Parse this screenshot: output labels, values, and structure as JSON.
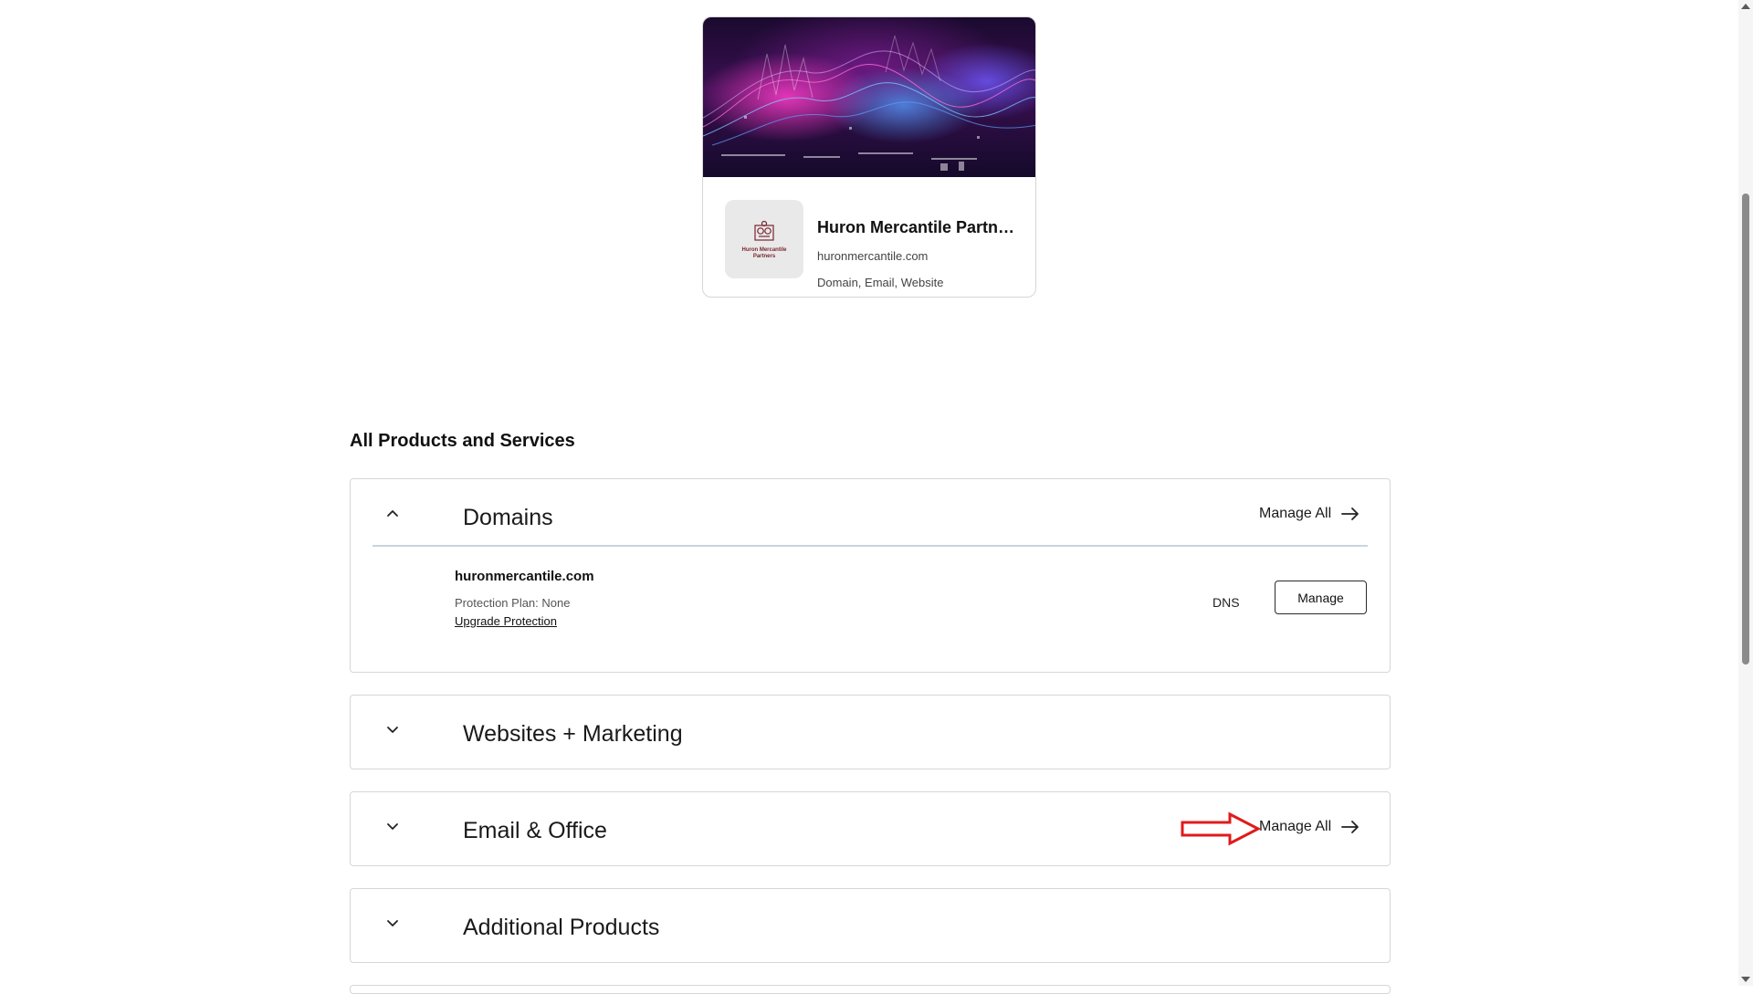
{
  "business_card": {
    "title": "Huron Mercantile Partners",
    "domain": "huronmercantile.com",
    "services": "Domain, Email, Website",
    "logo_text": "Huron Mercantile Partners"
  },
  "products": {
    "heading": "All Products and Services",
    "domains": {
      "title": "Domains",
      "manage_all": "Manage All",
      "domain_name": "huronmercantile.com",
      "protection_plan": "Protection Plan: None",
      "upgrade_link": "Upgrade Protection",
      "dns_label": "DNS",
      "manage_button": "Manage"
    },
    "websites": {
      "title": "Websites + Marketing"
    },
    "email": {
      "title": "Email & Office",
      "manage_all": "Manage All"
    },
    "additional": {
      "title": "Additional Products"
    }
  },
  "icons": {
    "expanded": "chevron-up-icon",
    "collapsed": "chevron-down-icon",
    "arrow": "arrow-right-icon",
    "annotation": "red-outline-arrow-icon"
  },
  "colors": {
    "annotation": "#e01b1b",
    "divider": "#c9d4de",
    "border": "#d6d6d6"
  }
}
